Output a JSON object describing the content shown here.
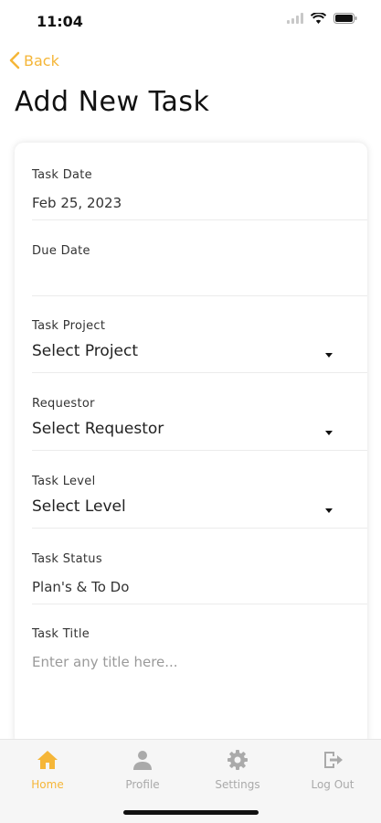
{
  "status": {
    "time": "11:04"
  },
  "nav": {
    "back_label": "Back"
  },
  "page": {
    "title": "Add New Task"
  },
  "form": {
    "task_date": {
      "label": "Task Date",
      "value": "Feb 25, 2023"
    },
    "due_date": {
      "label": "Due Date",
      "value": ""
    },
    "task_project": {
      "label": "Task Project",
      "value": "Select Project"
    },
    "requestor": {
      "label": "Requestor",
      "value": "Select Requestor"
    },
    "task_level": {
      "label": "Task Level",
      "value": "Select Level"
    },
    "task_status": {
      "label": "Task Status",
      "value": "Plan's & To Do"
    },
    "task_title": {
      "label": "Task Title",
      "placeholder": "Enter any title here..."
    }
  },
  "tabs": [
    {
      "label": "Home",
      "icon": "home-icon",
      "active": true
    },
    {
      "label": "Profile",
      "icon": "person-icon",
      "active": false
    },
    {
      "label": "Settings",
      "icon": "gear-icon",
      "active": false
    },
    {
      "label": "Log Out",
      "icon": "logout-icon",
      "active": false
    }
  ],
  "colors": {
    "accent": "#f5b638",
    "inactive": "#aaaaaa"
  }
}
